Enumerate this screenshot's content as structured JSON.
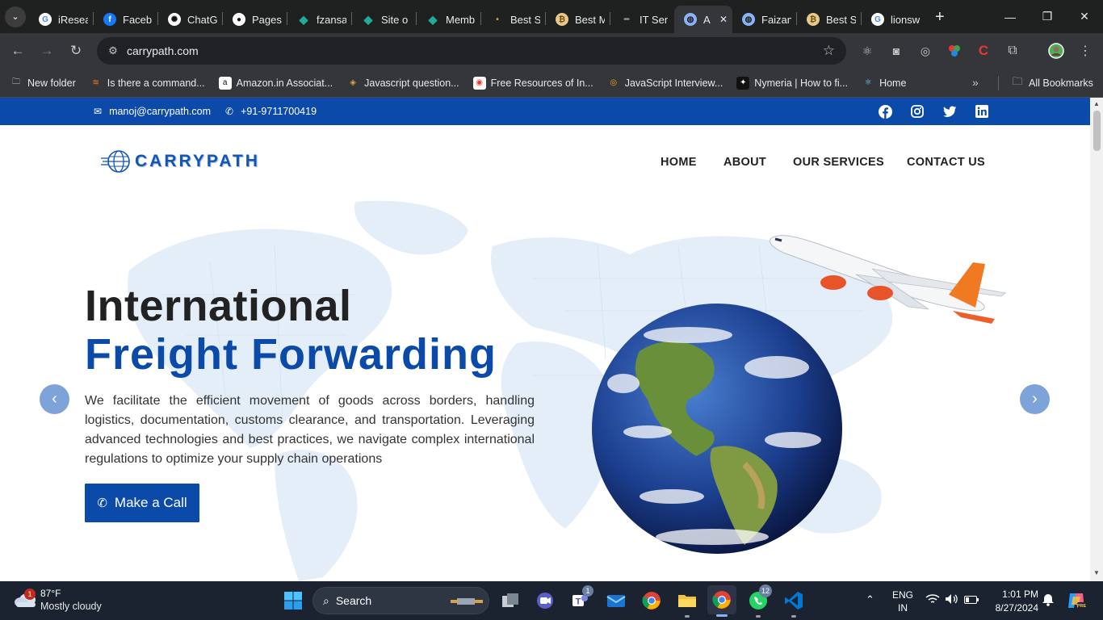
{
  "browser": {
    "tabs": [
      {
        "title": "iResea",
        "icon": "google-icon"
      },
      {
        "title": "Faceb",
        "icon": "facebook-icon"
      },
      {
        "title": "ChatG",
        "icon": "chatgpt-icon"
      },
      {
        "title": "Pages",
        "icon": "github-icon"
      },
      {
        "title": "fzansa",
        "icon": "diamond-icon"
      },
      {
        "title": "Site o",
        "icon": "diamond-icon"
      },
      {
        "title": "Memb",
        "icon": "diamond-icon"
      },
      {
        "title": "Best S",
        "icon": "dot-icon"
      },
      {
        "title": "Best M",
        "icon": "coin-icon"
      },
      {
        "title": "IT Ser",
        "icon": "dash-icon"
      },
      {
        "title": "A",
        "icon": "globe-icon",
        "active": true
      },
      {
        "title": "Faizan",
        "icon": "globe-icon"
      },
      {
        "title": "Best S",
        "icon": "coin-icon"
      },
      {
        "title": "lionsw",
        "icon": "google-icon"
      }
    ],
    "url": "carrypath.com",
    "bookmarks": [
      {
        "label": "New folder",
        "icon": "folder-icon"
      },
      {
        "label": "Is there a command...",
        "icon": "stackoverflow-icon"
      },
      {
        "label": "Amazon.in Associat...",
        "icon": "amazon-icon"
      },
      {
        "label": "Javascript question...",
        "icon": "compass-icon"
      },
      {
        "label": "Free Resources of In...",
        "icon": "image-icon"
      },
      {
        "label": "JavaScript Interview...",
        "icon": "js-icon"
      },
      {
        "label": "Nymeria | How to fi...",
        "icon": "bird-icon"
      },
      {
        "label": "Home",
        "icon": "react-icon"
      }
    ],
    "all_bookmarks": "All Bookmarks"
  },
  "site": {
    "email": "manoj@carrypath.com",
    "phone": "+91-9711700419",
    "logo_text": "CARRYPATH",
    "nav": [
      "HOME",
      "ABOUT",
      "OUR SERVICES",
      "CONTACT US"
    ],
    "hero": {
      "title_line1": "International",
      "title_line2": "Freight Forwarding",
      "description": "We facilitate the efficient movement of goods across borders, handling logistics, documentation, customs clearance, and transportation. Leveraging advanced technologies and best practices, we navigate complex international regulations to optimize your supply chain operations",
      "cta": "Make a Call"
    },
    "brand_color": "#0b4aa9"
  },
  "taskbar": {
    "weather_temp": "87°F",
    "weather_desc": "Mostly cloudy",
    "weather_badge": "1",
    "search_label": "Search",
    "teams_badge": "1",
    "whatsapp_badge": "12",
    "lang_line1": "ENG",
    "lang_line2": "IN",
    "time": "1:01 PM",
    "date": "8/27/2024"
  }
}
